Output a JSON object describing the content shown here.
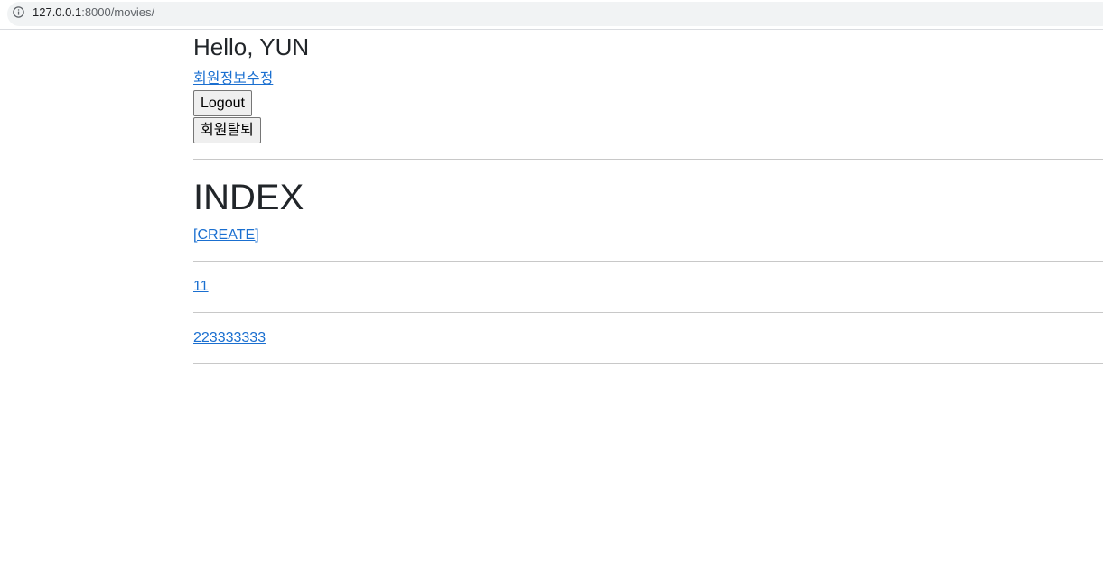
{
  "browser": {
    "url_host": "127.0.0.1",
    "url_path": ":8000/movies/",
    "info_icon": "info-icon"
  },
  "header": {
    "greeting": "Hello, YUN",
    "edit_profile_label": "회원정보수정",
    "logout_label": "Logout",
    "withdraw_label": "회원탈퇴"
  },
  "main": {
    "title": "INDEX",
    "create_label": "[CREATE]",
    "movies": [
      {
        "title": "11"
      },
      {
        "title": "223333333"
      }
    ]
  },
  "colors": {
    "link": "#1a6fd0",
    "text": "#212529",
    "divider": "#c8c8c8"
  }
}
